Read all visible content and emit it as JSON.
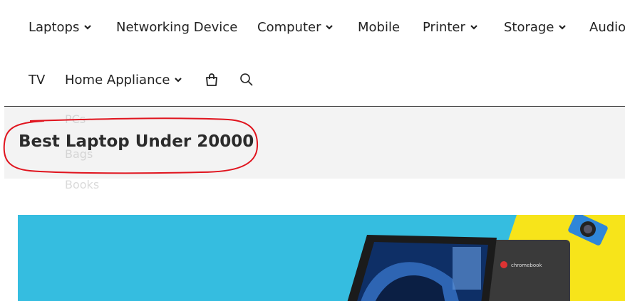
{
  "nav": {
    "row1": [
      {
        "label": "Laptops",
        "dropdown": true
      },
      {
        "label": "Networking Device",
        "dropdown": false
      },
      {
        "label": "Computer",
        "dropdown": true
      },
      {
        "label": "Mobile",
        "dropdown": false
      },
      {
        "label": "Printer",
        "dropdown": true
      },
      {
        "label": "Storage",
        "dropdown": true
      },
      {
        "label": "Audio",
        "dropdown": false
      }
    ],
    "row2": [
      {
        "label": "TV",
        "dropdown": false
      },
      {
        "label": "Home Appliance",
        "dropdown": true
      }
    ],
    "icons": [
      "shopping-bag-icon",
      "search-icon"
    ]
  },
  "ghost_menu": [
    "PCs",
    "Bags",
    "Books"
  ],
  "page": {
    "title": "Best Laptop Under 20000",
    "annotation_color": "#e0141e"
  },
  "banner": {
    "bg_color": "#35bde0",
    "accent_color": "#f7e41a",
    "laptop_logo": "chromebook"
  }
}
